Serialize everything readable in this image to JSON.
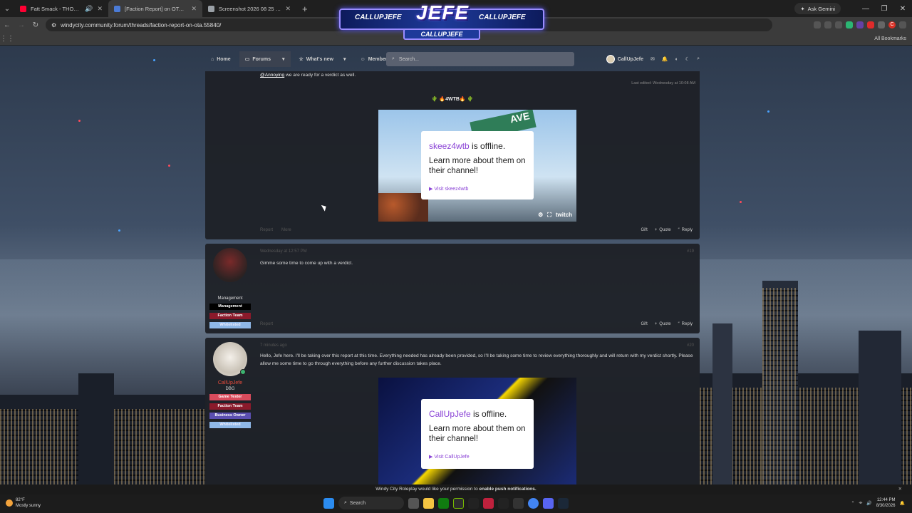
{
  "tabs": [
    {
      "title": "Fatt Smack - THOMASVILLE",
      "icon_color": "#ff0033",
      "active": false
    },
    {
      "title": "[Faction Report] on OTA | Windy City",
      "icon_color": "#4b7bd6",
      "active": true
    },
    {
      "title": "Screenshot 2026 08 25 100543",
      "icon_color": "#9aa0a6",
      "active": false
    }
  ],
  "browser": {
    "url": "windycity.community.forum/threads/faction-report-on-ota.55840/",
    "ask_gemini": "Ask Gemini",
    "all_bookmarks": "All Bookmarks",
    "profile_initial": "C"
  },
  "banner": {
    "left_handle": "CALLUPJEFE",
    "title": "JEFE",
    "right_handle": "CALLUPJEFE",
    "bottom_handle": "CALLUPJEFE"
  },
  "forum_nav": {
    "home": "Home",
    "forums": "Forums",
    "whats_new": "What's new",
    "members": "Members",
    "search_placeholder": "Search...",
    "username": "CallUpJefe"
  },
  "post1": {
    "mention": "@Annoying",
    "text": " we are ready for a verdict as well.",
    "edited": "Last edited: Wednesday at 10:08 AM",
    "signature": "🌵 🔥4WTB🔥 🌵",
    "embed": {
      "channel": "skeez4wtb",
      "status": " is offline.",
      "line": "Learn more about them on their channel!",
      "visit": "Visit skeez4wtb",
      "brand": "twitch",
      "street": "AVE"
    },
    "left_actions": [
      "Report",
      "More"
    ],
    "actions": [
      "Gift",
      "Quote",
      "Reply"
    ]
  },
  "post2": {
    "date": "Wednesday at 12:57 PM",
    "num": "#19",
    "text": "Gimme some time to come up with a verdict.",
    "role": "Management",
    "badges": [
      {
        "label": "Management",
        "color": "#000000"
      },
      {
        "label": "Faction Team",
        "color": "#8b1a2b"
      },
      {
        "label": "Whitelisted",
        "color": "#8fb8e8"
      }
    ],
    "left_actions": [
      "Report"
    ],
    "actions": [
      "Gift",
      "Quote",
      "Reply"
    ]
  },
  "post3": {
    "date": "7 minutes ago",
    "num": "#20",
    "username": "CallUpJefe",
    "role": "DBG",
    "text": "Hello, Jefe here. I'll be taking over this report at this time. Everything needed has already been provided, so I'll be taking some time to review everything thoroughly and will return with my verdict shortly. Please allow me some time to go through everything before any further discussion takes place.",
    "badges": [
      {
        "label": "Game Tester",
        "color": "#d94b5c"
      },
      {
        "label": "Faction Team",
        "color": "#8b1a2b"
      },
      {
        "label": "Business Owner",
        "color": "#5b4fb0"
      },
      {
        "label": "Whitelisted",
        "color": "#8fb8e8"
      }
    ],
    "embed": {
      "channel": "CallUpJefe",
      "status": " is offline.",
      "line": "Learn more about them on their channel!",
      "visit": "Visit CallUpJefe",
      "brand": "twitch"
    }
  },
  "notification": {
    "text": "Windy City Roleplay would like your permission to ",
    "link": "enable push notifications."
  },
  "taskbar": {
    "temp": "82°F",
    "weather": "Mostly sunny",
    "search": "Search",
    "time": "12:44 PM",
    "date": "8/30/2026"
  }
}
